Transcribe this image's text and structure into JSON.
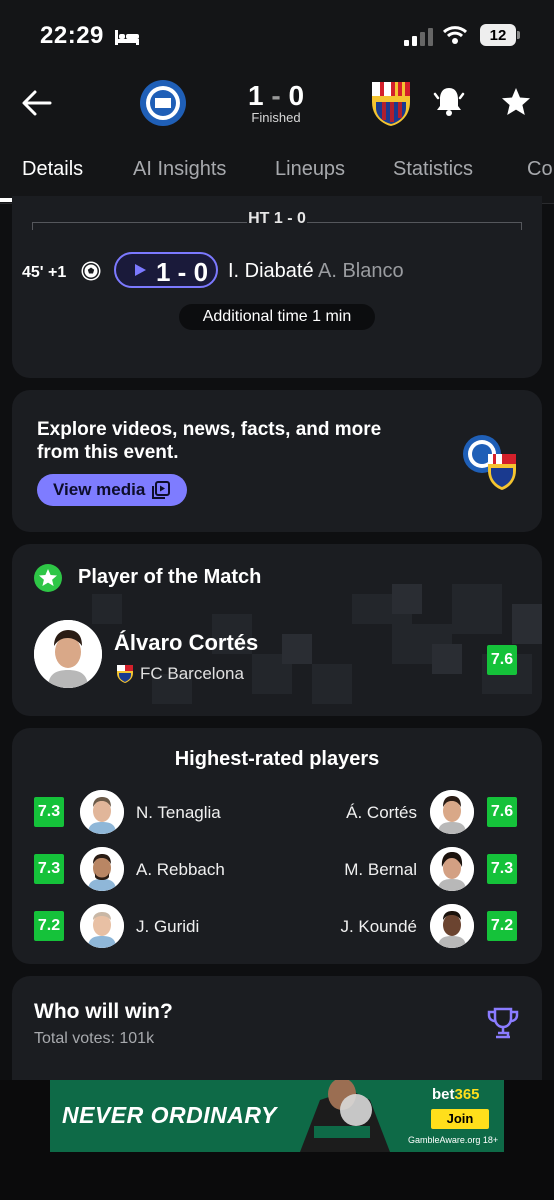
{
  "status_bar": {
    "time": "22:29",
    "battery": "12"
  },
  "header": {
    "score": {
      "home": "1",
      "separator": "-",
      "away": "0"
    },
    "status": "Finished",
    "colors": {
      "accent": "#7c79ff",
      "rating_green": "#15c23a"
    }
  },
  "tabs": [
    {
      "label": "Details",
      "active": true
    },
    {
      "label": "AI Insights"
    },
    {
      "label": "Lineups"
    },
    {
      "label": "Statistics"
    },
    {
      "label": "Co"
    }
  ],
  "timeline": {
    "ht_label": "HT 1 - 0",
    "event": {
      "minute": "45' +1",
      "score": "1 - 0",
      "scorer": "I. Diabaté",
      "assist": "A. Blanco"
    },
    "additional_time": "Additional time 1 min"
  },
  "media": {
    "text": "Explore videos, news, facts, and more from this event.",
    "button": "View media"
  },
  "player_of_match": {
    "title": "Player of the Match",
    "name": "Álvaro Cortés",
    "club": "FC Barcelona",
    "rating": "7.6"
  },
  "highest_rated": {
    "title": "Highest-rated players",
    "home": [
      {
        "rating": "7.3",
        "name": "N. Tenaglia"
      },
      {
        "rating": "7.3",
        "name": "A. Rebbach"
      },
      {
        "rating": "7.2",
        "name": "J. Guridi"
      }
    ],
    "away": [
      {
        "rating": "7.6",
        "name": "Á. Cortés"
      },
      {
        "rating": "7.3",
        "name": "M. Bernal"
      },
      {
        "rating": "7.2",
        "name": "J. Koundé"
      }
    ]
  },
  "prediction": {
    "title": "Who will win?",
    "votes": "Total votes: 101k"
  },
  "ad": {
    "slogan": "NEVER ORDINARY",
    "brand_a": "bet",
    "brand_b": "365",
    "cta": "Join",
    "disclaimer": "GambleAware.org 18+"
  }
}
